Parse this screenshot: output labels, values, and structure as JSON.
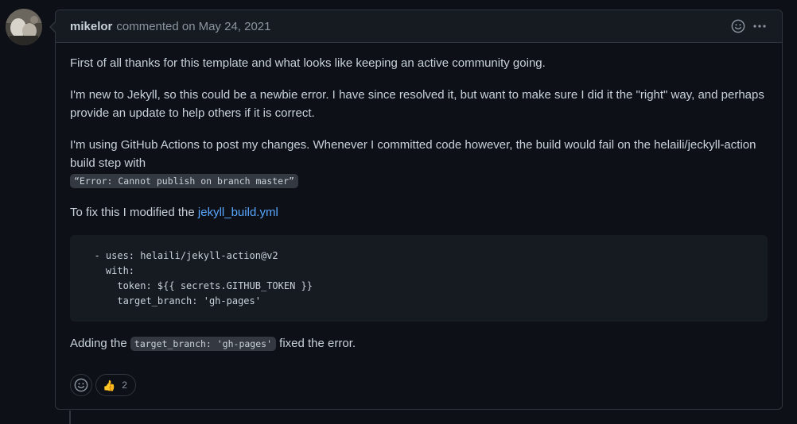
{
  "comment": {
    "author": "mikelor",
    "action": "commented on",
    "date": "May 24, 2021",
    "body": {
      "p1": "First of all thanks for this template and what looks like keeping an active community going.",
      "p2": "I'm new to Jekyll, so this could be a newbie error. I have since resolved it, but want to make sure I did it the \"right\" way, and perhaps provide an update to help others if it is correct.",
      "p3": "I'm using GitHub Actions to post my changes. Whenever I committed code however, the build would fail on the helaili/jeckyll-action build step with",
      "p3_code": "“Error: Cannot publish on branch master”",
      "p4_prefix": "To fix this I modified the ",
      "p4_link": "jekyll_build.yml",
      "code_block": [
        "  - uses: helaili/jekyll-action@v2",
        "    with:",
        "      token: ${{ secrets.GITHUB_TOKEN }}",
        "      target_branch: 'gh-pages'"
      ],
      "p5_prefix": "Adding the ",
      "p5_code": "target_branch: 'gh-pages'",
      "p5_suffix": " fixed the error."
    },
    "reactions": {
      "thumbs_up_emoji": "👍",
      "thumbs_up_count": "2"
    }
  },
  "icons": {
    "header_reaction": "smiley-icon",
    "header_menu": "kebab-horizontal-icon",
    "add_reaction": "smiley-icon"
  },
  "colors": {
    "background": "#0d1117",
    "header_bg": "#161b22",
    "border": "#30363d",
    "text": "#c9d1d9",
    "muted": "#8b949e",
    "link": "#58a6ff"
  }
}
